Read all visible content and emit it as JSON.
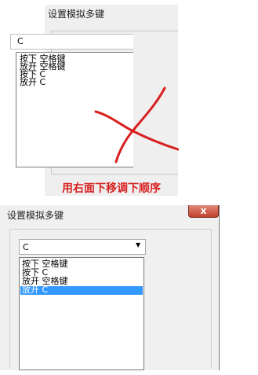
{
  "top_dialog": {
    "title": "设置模拟多键",
    "combo_value": "C",
    "list_items": [
      "按下 空格键",
      "放开 空格键",
      "按下 C",
      "放开 C"
    ],
    "hint": "用右面下移调下顺序"
  },
  "bottom_dialog": {
    "title": "设置模拟多键",
    "close_label": "x",
    "combo_value": "C",
    "combo_arrow": "▼",
    "list_items": [
      "按下 空格键",
      "按下 C",
      "放开 空格键",
      "放开 C"
    ],
    "selected_index": 3
  },
  "colors": {
    "annotation_red": "#d82020",
    "selection_blue": "#3399ff"
  }
}
